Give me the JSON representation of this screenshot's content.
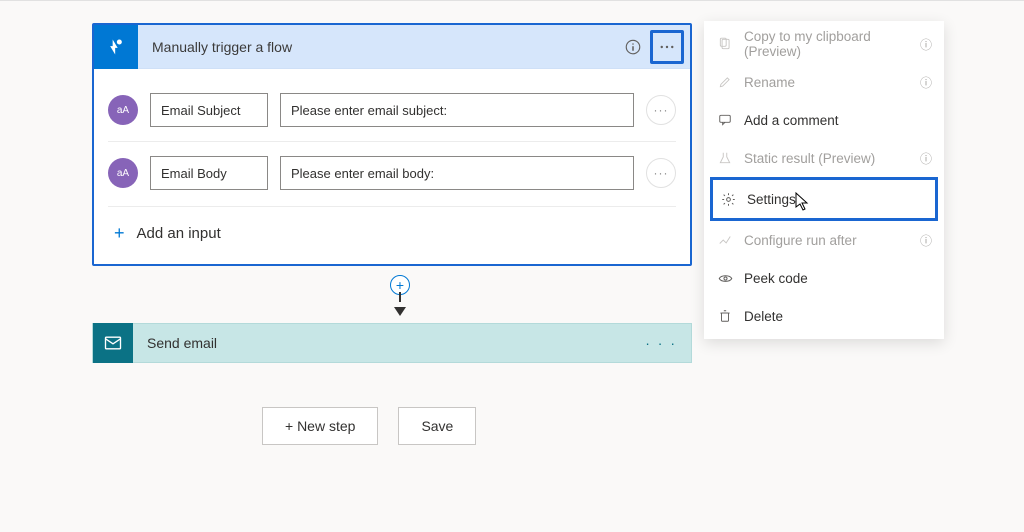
{
  "trigger": {
    "title": "Manually trigger a flow",
    "inputs": [
      {
        "name": "Email Subject",
        "placeholder": "Please enter email subject:",
        "type_badge": "aA"
      },
      {
        "name": "Email Body",
        "placeholder": "Please enter email body:",
        "type_badge": "aA"
      }
    ],
    "add_input_label": "Add an input"
  },
  "action": {
    "title": "Send email"
  },
  "bottom": {
    "new_step": "+ New step",
    "save": "Save"
  },
  "menu": {
    "copy": "Copy to my clipboard (Preview)",
    "rename": "Rename",
    "comment": "Add a comment",
    "static": "Static result (Preview)",
    "settings": "Settings",
    "runafter": "Configure run after",
    "peek": "Peek code",
    "delete": "Delete"
  }
}
